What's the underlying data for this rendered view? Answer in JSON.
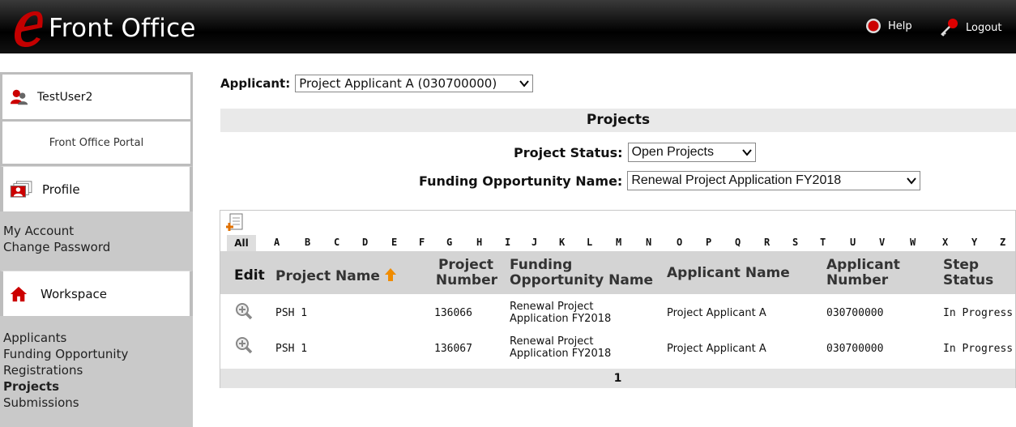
{
  "header": {
    "logo_text": "Front Office",
    "help_label": "Help",
    "logout_label": "Logout"
  },
  "sidebar": {
    "user_name": "TestUser2",
    "portal_label": "Front Office Portal",
    "profile_label": "Profile",
    "account_links": [
      "My Account",
      "Change Password"
    ],
    "workspace_label": "Workspace",
    "workspace_links": [
      "Applicants",
      "Funding Opportunity",
      "Registrations",
      "Projects",
      "Submissions"
    ],
    "active_link": "Projects"
  },
  "main": {
    "applicant_label": "Applicant:",
    "applicant_value": "Project Applicant A (030700000)",
    "section_title": "Projects",
    "status_label": "Project Status:",
    "status_value": "Open Projects",
    "funding_label": "Funding Opportunity Name:",
    "funding_value": "Renewal Project Application FY2018"
  },
  "grid": {
    "alpha_all": "All",
    "alpha": [
      "A",
      "B",
      "C",
      "D",
      "E",
      "F",
      "G",
      "H",
      "I",
      "J",
      "K",
      "L",
      "M",
      "N",
      "O",
      "P",
      "Q",
      "R",
      "S",
      "T",
      "U",
      "V",
      "W",
      "X",
      "Y",
      "Z"
    ],
    "columns": {
      "edit": "Edit",
      "project_name": "Project Name",
      "project_number_1": "Project",
      "project_number_2": "Number",
      "funding_1": "Funding",
      "funding_2": "Opportunity Name",
      "applicant_name": "Applicant Name",
      "applicant_number_1": "Applicant",
      "applicant_number_2": "Number",
      "step_1": "Step",
      "step_2": "Status"
    },
    "rows": [
      {
        "project_name": "PSH 1",
        "project_number": "136066",
        "funding_1": "Renewal Project",
        "funding_2": "Application FY2018",
        "applicant_name": "Project Applicant A",
        "applicant_number": "030700000",
        "status": "In Progress"
      },
      {
        "project_name": "PSH 1",
        "project_number": "136067",
        "funding_1": "Renewal Project",
        "funding_2": "Application FY2018",
        "applicant_name": "Project Applicant A",
        "applicant_number": "030700000",
        "status": "In Progress"
      }
    ],
    "page": "1"
  }
}
